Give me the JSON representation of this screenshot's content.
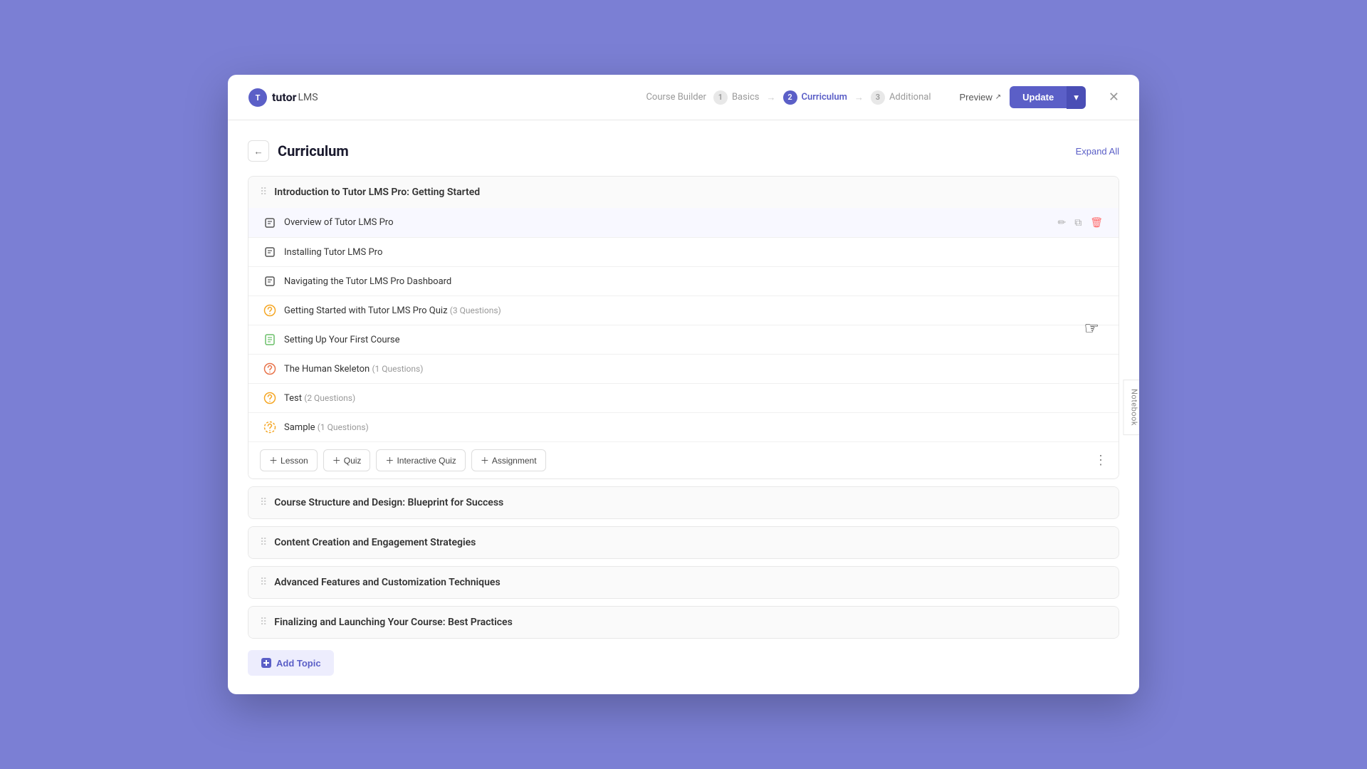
{
  "logo": {
    "text": "tutor",
    "lms": "LMS"
  },
  "header": {
    "course_builder": "Course Builder",
    "step1": {
      "num": "1",
      "label": "Basics"
    },
    "step2": {
      "num": "2",
      "label": "Curriculum"
    },
    "step3": {
      "num": "3",
      "label": "Additional"
    },
    "preview": "Preview",
    "update": "Update",
    "expand_all": "Expand All"
  },
  "page": {
    "title": "Curriculum"
  },
  "topics": [
    {
      "title": "Introduction to Tutor LMS Pro: Getting Started",
      "expanded": true,
      "items": [
        {
          "type": "lesson",
          "title": "Overview of Tutor LMS Pro",
          "hovered": true
        },
        {
          "type": "lesson",
          "title": "Installing Tutor LMS Pro"
        },
        {
          "type": "lesson",
          "title": "Navigating the Tutor LMS Pro Dashboard"
        },
        {
          "type": "quiz",
          "title": "Getting Started with Tutor LMS Pro Quiz",
          "questions": "(3 Questions)"
        },
        {
          "type": "assignment",
          "title": "Setting Up Your First Course"
        },
        {
          "type": "quiz_orange",
          "title": "The Human Skeleton",
          "questions": "(1 Questions)"
        },
        {
          "type": "quiz",
          "title": "Test",
          "questions": "(2 Questions)"
        },
        {
          "type": "quiz_dashed",
          "title": "Sample",
          "questions": "(1 Questions)"
        }
      ],
      "add_buttons": [
        "Lesson",
        "Quiz",
        "Interactive Quiz",
        "Assignment"
      ]
    },
    {
      "title": "Course Structure and Design: Blueprint for Success",
      "expanded": false,
      "items": [],
      "add_buttons": []
    },
    {
      "title": "Content Creation and Engagement Strategies",
      "expanded": false,
      "items": [],
      "add_buttons": []
    },
    {
      "title": "Advanced Features and Customization Techniques",
      "expanded": false,
      "items": [],
      "add_buttons": []
    },
    {
      "title": "Finalizing and Launching Your Course: Best Practices",
      "expanded": false,
      "items": [],
      "add_buttons": []
    }
  ],
  "add_topic_label": "Add Topic",
  "notebook_label": "Notebook"
}
